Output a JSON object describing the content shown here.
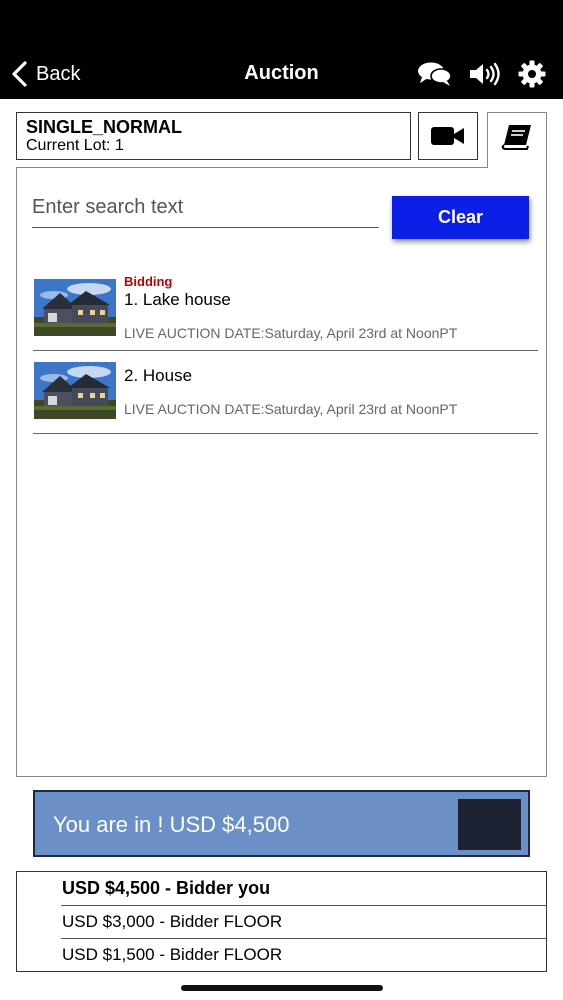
{
  "nav": {
    "back_label": "Back",
    "title": "Auction",
    "icons": [
      "chat-icon",
      "speaker-icon",
      "gear-icon"
    ]
  },
  "lot_header": {
    "name": "SINGLE_NORMAL",
    "current_lot": "Current Lot: 1"
  },
  "tabs": [
    "video-camera-icon",
    "catalog-book-icon"
  ],
  "search": {
    "placeholder": "Enter search text",
    "value": "",
    "clear_label": "Clear"
  },
  "lots": [
    {
      "status": "Bidding",
      "title": "1. Lake house",
      "date": "LIVE AUCTION DATE:Saturday, April 23rd at NoonPT"
    },
    {
      "status": "",
      "title": "2. House",
      "date": "LIVE AUCTION DATE:Saturday, April 23rd at NoonPT"
    }
  ],
  "bid_status": {
    "text": "You are in ! USD $4,500"
  },
  "bid_history": [
    {
      "text": "USD $4,500 - Bidder you",
      "bold": true
    },
    {
      "text": "USD $3,000 - Bidder FLOOR",
      "bold": false
    },
    {
      "text": "USD $1,500 - Bidder FLOOR",
      "bold": false
    }
  ],
  "colors": {
    "nav_bg": "#000000",
    "clear_button": "#0c1fe6",
    "status_bidding": "#c00000",
    "bid_bar": "#6b8fc7"
  }
}
